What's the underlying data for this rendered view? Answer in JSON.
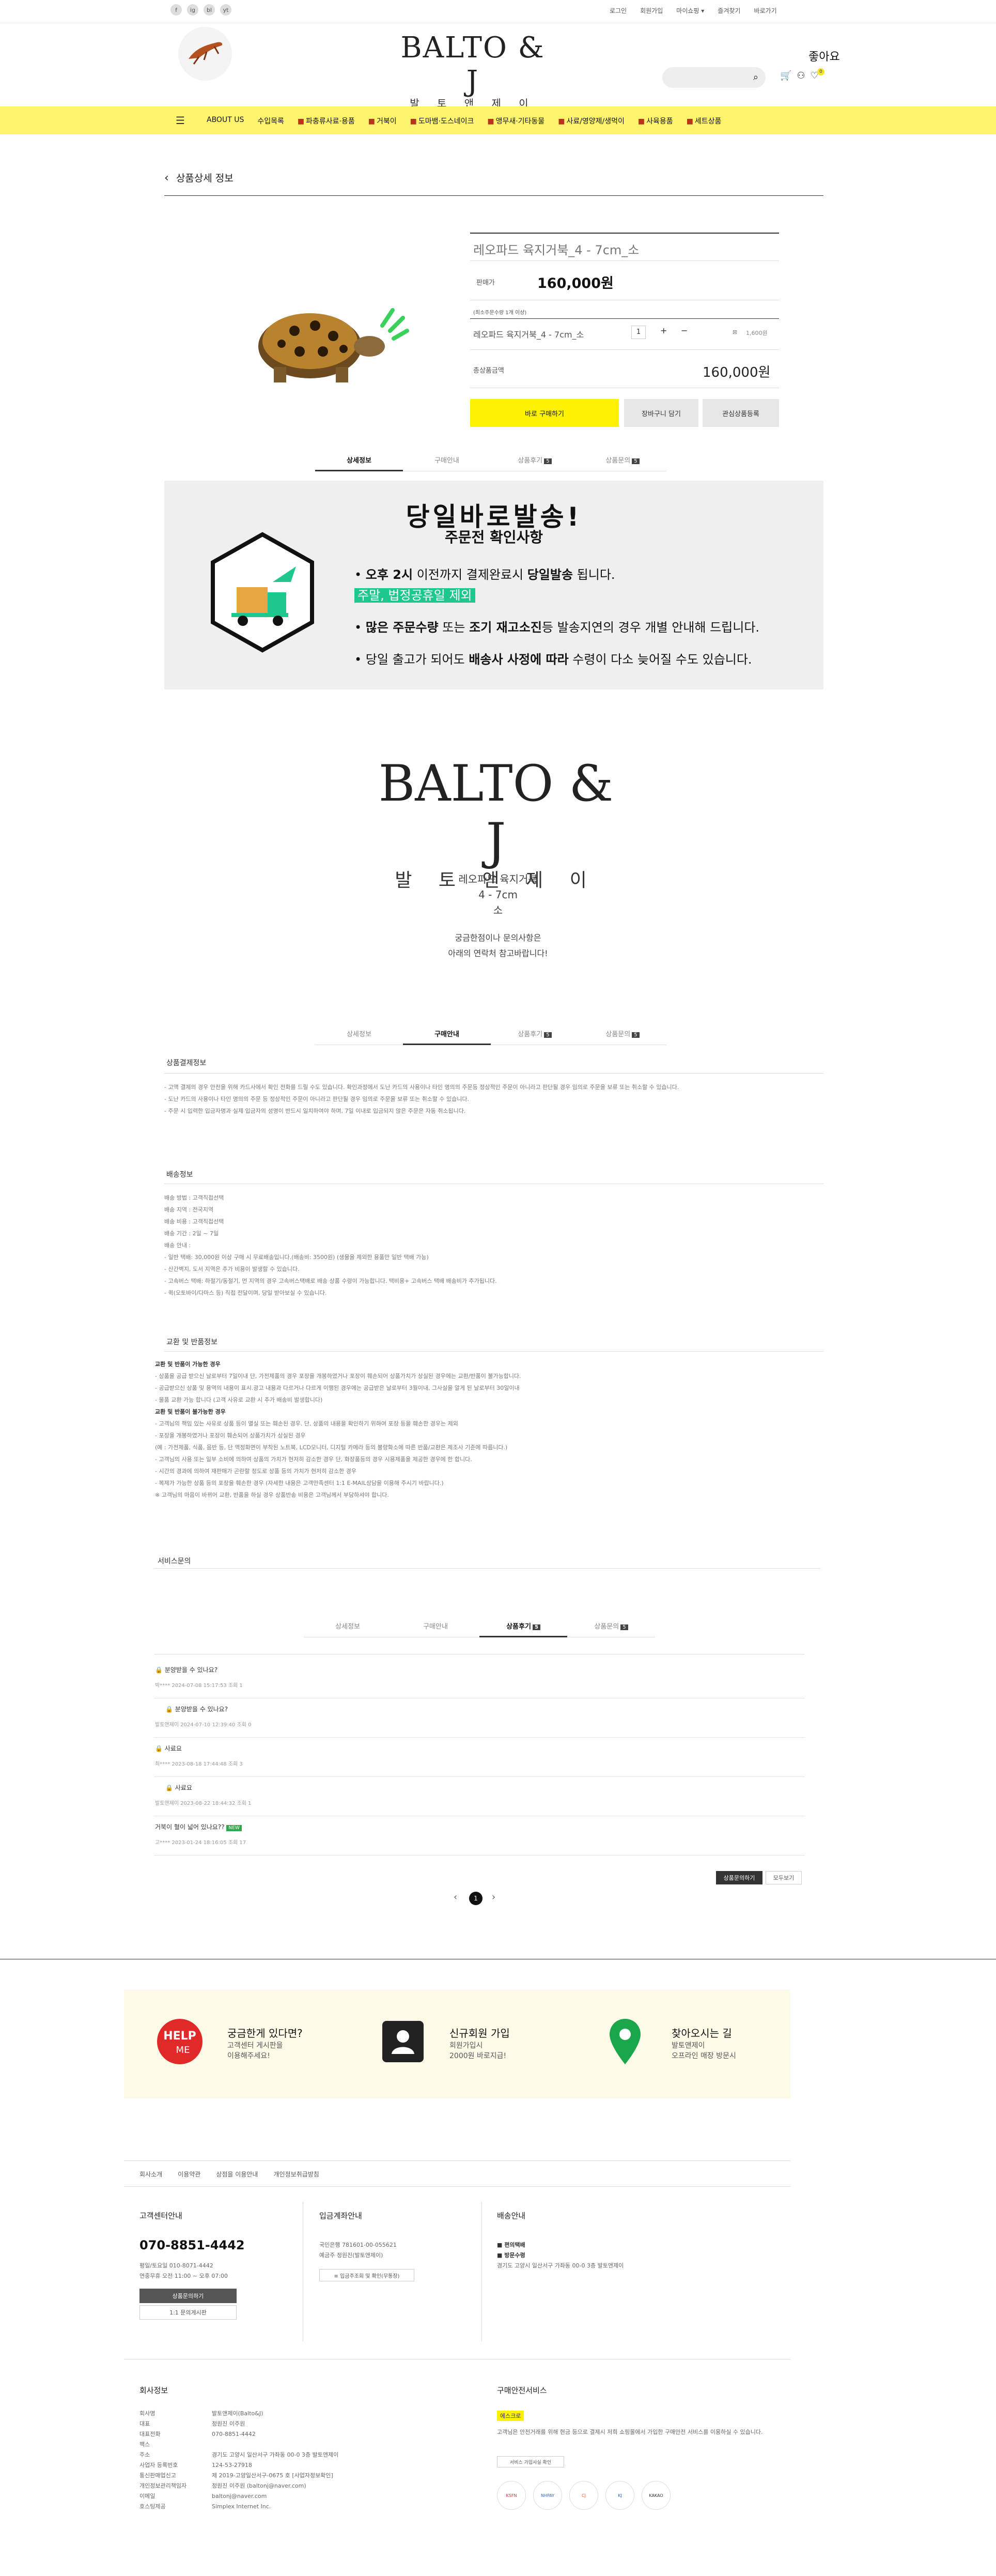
{
  "sns": [
    "f",
    "ig",
    "bl",
    "yt"
  ],
  "top_links": [
    "로그인",
    "회원가입",
    "마이쇼핑 ▾",
    "즐겨찾기",
    "바로가기"
  ],
  "brand": {
    "logo_text": "BALTO & J",
    "logo_sub": "발 토 앤 제 이"
  },
  "like_label": "좋아요",
  "cart_count": "0",
  "nav": [
    "ABOUT US",
    "수입목록",
    "파충류사료·용품",
    "거북이",
    "도마뱀·도스네이크",
    "앵무새·기타동물",
    "사료/영양제/생먹이",
    "사육용품",
    "세트상품"
  ],
  "page_title": "상품상세 정보",
  "product": {
    "name": "레오파드 육지거북_4 - 7cm_소",
    "price_label": "판매가",
    "price": "160,000원",
    "option_note": "(최소주문수량 1개 이상)",
    "option_name": "레오파드 육지거북_4 - 7cm_소",
    "qty": "1",
    "qty_plus": "+",
    "qty_minus": "−",
    "option_price": "1,600원",
    "total_label": "총상품금액",
    "total": "160,000원",
    "buy_btn": "바로 구매하기",
    "cart_btn": "장바구니 담기",
    "wish_btn": "관심상품등록"
  },
  "tabs": [
    {
      "label": "상세정보",
      "count": ""
    },
    {
      "label": "구매안내",
      "count": ""
    },
    {
      "label": "상품후기",
      "count": "5"
    },
    {
      "label": "상품문의",
      "count": "5"
    }
  ],
  "banner": {
    "title": "당일바로발송!",
    "subtitle": "주문전 확인사항",
    "line1_a": "• ",
    "line1_b": "오후 2시",
    "line1_c": " 이전까지 결제완료시 ",
    "line1_d": "당일발송",
    "line1_e": " 됩니다.",
    "line1_hl": "주말, 법정공휴일 제외",
    "line2_a": "• ",
    "line2_b": "많은 주문수량",
    "line2_c": " 또는 ",
    "line2_d": "조기 재고소진",
    "line2_e": "등 발송지연의 경우 개별 안내해 드립니다.",
    "line3_a": "• 당일 출고가 되어도 ",
    "line3_b": "배송사 사정에 따라",
    "line3_c": " 수령이 다소 늦어질 수도 있습니다."
  },
  "product_desc": [
    "레오파드 육지거북",
    "4 - 7cm",
    "소"
  ],
  "product_desc2": [
    "궁금한점이나 문의사항은",
    "아래의 연락처 참고바랍니다!"
  ],
  "section_payment": {
    "title": "상품결제정보",
    "lines": [
      "- 고액 결제의 경우 안전을 위해 카드사에서 확인 전화를 드릴 수도 있습니다. 확인과정에서 도난 카드의 사용이나 타인 명의의 주문등 정상적인 주문이 아니라고 판단될 경우 임의로 주문을 보류 또는 취소할 수 있습니다.",
      "- 도난 카드의 사용이나 타인 명의의 주문 등 정상적인 주문이 아니라고 판단될 경우 임의로 주문을 보류 또는 취소할 수 있습니다.",
      "- 주문 시 입력한 입금자명과 실제 입금자의 성명이 반드시 일치하여야 하며, 7일 이내로 입금되지 않은 주문은 자동 취소됩니다."
    ]
  },
  "section_delivery": {
    "title": "배송정보",
    "lines": [
      "배송 방법 : 고객직접선택",
      "배송 지역 : 전국지역",
      "배송 비용 : 고객직접선택",
      "배송 기간 : 2일 ~ 7일",
      "배송 안내 :",
      "- 일반 택배: 30,000원 이상 구매 시 무료배송입니다.(배송비: 3500원) (생물을 제외한 용품만 일반 택배 가능)",
      "- 산간벽지, 도서 지역은 추가 비용이 발생할 수 있습니다.",
      "- 고속버스 택배: 하절기/동절기, 먼 지역의 경우 고속버스택배로 배송 상품 수령이 가능합니다. 택비용+ 고속버스 택배 배송비가 추가됩니다.",
      "- 퀵(오토바이/다마스 등) 직접 전달이며, 당일 받아보실 수 있습니다."
    ]
  },
  "section_return": {
    "title": "교환 및 반품정보",
    "lines": [
      "교환 및 반품이 가능한 경우",
      "- 상품을 공급 받으신 날로부터 7일이내 단, 가전제품의 경우 포장을 개봉하였거나 포장이 훼손되어 상품가치가 상실된 경우에는 교환/반품이 불가능합니다.",
      "- 공급받으신 상품 및 용역의 내용이 표시.광고 내용과 다르거나 다르게 이행된 경우에는 공급받은 날로부터 3월이내, 그사실을 알게 된 날로부터 30일이내",
      "- 물품 교환 가능 합니다 (고객 사유로 교환 시 추가 배송비 발생합니다)",
      "교환 및 반품이 불가능한 경우",
      "- 고객님의 책임 있는 사유로 상품 등이 멸실 또는 훼손된 경우. 단, 상품의 내용을 확인하기 위하여 포장 등을 훼손한 경우는 제외",
      "- 포장을 개봉하였거나 포장이 훼손되어 상품가치가 상실된 경우",
      "(예 : 가전제품, 식품, 음반 등, 단 액정화면이 부착된 노트북, LCD모니터, 디지털 카메라 등의 불량화소에 따른 반품/교환은 제조사 기준에 따릅니다.)",
      "- 고객님의 사용 또는 일부 소비에 의하여 상품의 가치가 현저히 감소한 경우 단, 화장품등의 경우 시용제품을 제공한 경우에 한 합니다.",
      "- 시간의 경과에 의하여 재판매가 곤란할 정도로 상품 등의 가치가 현저히 감소한 경우",
      "- 복제가 가능한 상품 등의 포장을 훼손한 경우 (자세한 내용은 고객만족센터 1:1 E-MAIL상담을 이용해 주시기 바랍니다.)",
      "※ 고객님의 마음이 바뀌어 교환, 반품을 하실 경우 상품반송 비용은 고객님께서 부담하셔야 합니다."
    ]
  },
  "section_service": {
    "title": "서비스문의"
  },
  "reviews": [
    {
      "title": "🔒 분양받을 수 있나요?",
      "meta": "박****  2024-07-08 15:17:53  조회 1",
      "isnew": ""
    },
    {
      "title": "🔒 분양받을 수 있나요?",
      "meta": "발토앤제이  2024-07-10 12:39:40  조회 0",
      "isnew": ""
    },
    {
      "title": "🔒 사료요",
      "meta": "최****  2023-08-18 17:44:48  조회 3",
      "isnew": ""
    },
    {
      "title": "🔒 사료요",
      "meta": "발토앤제이  2023-08-22 18:44:32  조회 1",
      "isnew": ""
    },
    {
      "title": "거북이 혈이 넓어 있나요??",
      "meta": "고****  2023-01-24 18:16:05  조회 17",
      "isnew": "NEW"
    }
  ],
  "write_btn": "상품문의하기",
  "all_btn": "모두보기",
  "pager": {
    "prev": "‹",
    "current": "1",
    "next": "›"
  },
  "cards": [
    {
      "title": "궁금한게 있다면?",
      "sub1": "고객센터 게시판을",
      "sub2": "이용해주세요!"
    },
    {
      "title": "신규회원 가입",
      "sub1": "회원가입시",
      "sub2": "2000원 바로지급!"
    },
    {
      "title": "찾아오시는 길",
      "sub1": "발토앤제이",
      "sub2": "오프라인 매장 방문시"
    }
  ],
  "footer_links": [
    "회사소개",
    "이용약관",
    "상점을 이용안내",
    "개인정보취급방침"
  ],
  "cs": {
    "title": "고객센터안내",
    "phone": "070-8851-4442",
    "l1": "평일/토요일   010-8071-4442",
    "l2": "연중무휴   오전 11:00 ~ 오후 07:00",
    "btn": "상품문의하기",
    "btn2": "1:1 문의게시판"
  },
  "bank": {
    "title": "입금계좌안내",
    "l1": "국민은행 781601-00-055621",
    "l2": "예금주  정원진(발토앤제이)",
    "btn": "≡ 입금주조회 및 확인(무통장)"
  },
  "ship": {
    "title": "배송안내",
    "l1": "■ 편의택배",
    "l2": "■ 방문수령",
    "l3": "경기도 고양시 일산서구 가좌동 00-0 3층 발토앤제이"
  },
  "company": {
    "title": "회사정보",
    "rows": [
      [
        "회사명",
        "발토앤제이(Balto&J)"
      ],
      [
        "대표",
        "정원진 이주원"
      ],
      [
        "대표전화",
        "070-8851-4442"
      ],
      [
        "팩스",
        ""
      ],
      [
        "주소",
        "경기도 고양시 일산서구 가좌동 00-0 3층 발토앤제이"
      ],
      [
        "사업자 등록번호",
        "124-53-27918"
      ],
      [
        "통신판매업신고",
        "제 2019-고양일산서구-0675 호 [사업자정보확인]"
      ],
      [
        "개인정보관리책임자",
        "정원진 이주원 (baltonj@naver.com)"
      ],
      [
        "이메일",
        "baltonj@naver.com"
      ],
      [
        "호스팅제공",
        "Simplex Internet Inc."
      ]
    ]
  },
  "safety": {
    "title": "구매안전서비스",
    "badge": "에스크로",
    "text": "고객님은 안전거래를 위해 현금 등으로 결제시 저희 쇼핑몰에서 가입한 구매안전 서비스를 이용하실 수 있습니다.",
    "btn": "서비스 가입사실 확인",
    "logos": [
      "KSFN",
      "NHPAY",
      "CJ",
      "KJ",
      "KAKAO"
    ]
  }
}
